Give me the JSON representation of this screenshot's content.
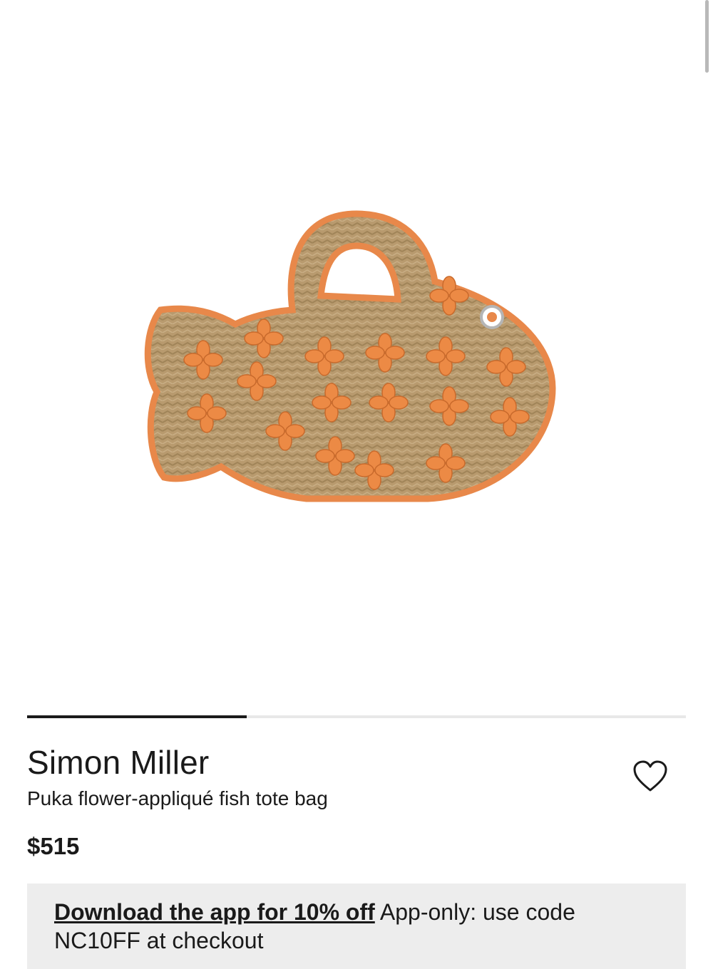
{
  "product": {
    "brand": "Simon Miller",
    "name": "Puka flower-appliqué fish tote bag",
    "price": "$515",
    "image": {
      "description_icon": "fish-tote-bag-image",
      "colors": {
        "straw": "#b89a6e",
        "trim": "#e8884a",
        "shell": "#ec8a45"
      }
    }
  },
  "carousel": {
    "current": 1,
    "total": 3,
    "progress": 0.333
  },
  "wishlist": {
    "icon": "heart-outline-icon"
  },
  "promo": {
    "link_text": "Download the app for 10% off",
    "text": " App-only: use code NC10FF at checkout",
    "background": "#ededed"
  },
  "colors": {
    "text": "#1a1a1a",
    "indicator_active": "#1a1a1a",
    "indicator_track": "#e8e8e8"
  }
}
